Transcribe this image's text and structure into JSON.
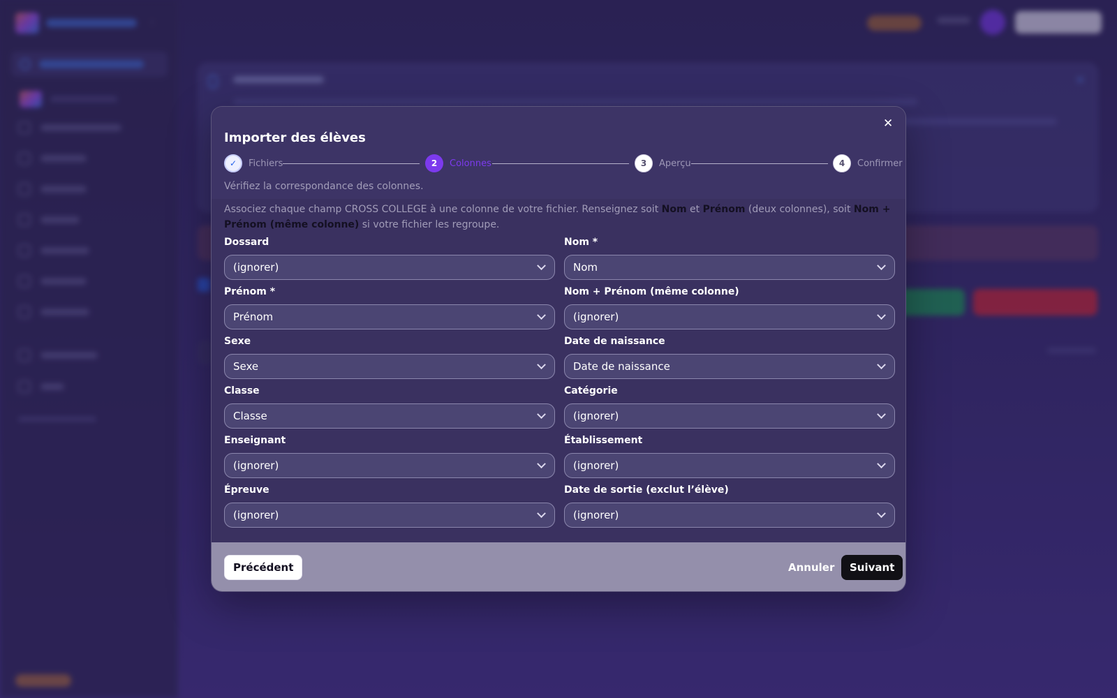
{
  "modal": {
    "title": "Importer des élèves",
    "close_glyph": "✕",
    "steps": [
      {
        "label": "Fichiers",
        "status": "done",
        "glyph": "✓"
      },
      {
        "label": "Colonnes",
        "status": "active",
        "number": "2"
      },
      {
        "label": "Aperçu",
        "status": "todo",
        "number": "3"
      },
      {
        "label": "Confirmer",
        "status": "todo",
        "number": "4"
      }
    ],
    "subtitle": "Vérifiez la correspondance des colonnes.",
    "help": {
      "part1": "Associez chaque champ CROSS COLLEGE à une colonne de votre fichier. Renseignez soit ",
      "bold1": "Nom",
      "part2": " et ",
      "bold2": "Prénom",
      "part3": " (deux colonnes), soit ",
      "bold3": "Nom + Prénom (même colonne)",
      "part4": " si votre fichier les regroupe."
    },
    "fields": [
      {
        "label": "Dossard",
        "value": "(ignorer)"
      },
      {
        "label": "Nom *",
        "value": "Nom"
      },
      {
        "label": "Prénom *",
        "value": "Prénom"
      },
      {
        "label": "Nom + Prénom (même colonne)",
        "value": "(ignorer)"
      },
      {
        "label": "Sexe",
        "value": "Sexe"
      },
      {
        "label": "Date de naissance",
        "value": "Date de naissance"
      },
      {
        "label": "Classe",
        "value": "Classe"
      },
      {
        "label": "Catégorie",
        "value": "(ignorer)"
      },
      {
        "label": "Enseignant",
        "value": "(ignorer)"
      },
      {
        "label": "Établissement",
        "value": "(ignorer)"
      },
      {
        "label": "Épreuve",
        "value": "(ignorer)"
      },
      {
        "label": "Date de sortie (exclut l’élève)",
        "value": "(ignorer)"
      }
    ],
    "footer": {
      "previous": "Précédent",
      "cancel": "Annuler",
      "next": "Suivant"
    }
  },
  "colors": {
    "accent_violet": "#7c3aed",
    "brand_blue": "#4f8cff",
    "primary_button": "#111015"
  },
  "icons": {
    "close": "close-icon",
    "step_done": "check-icon",
    "select_chevron": "chevron-down-icon"
  }
}
